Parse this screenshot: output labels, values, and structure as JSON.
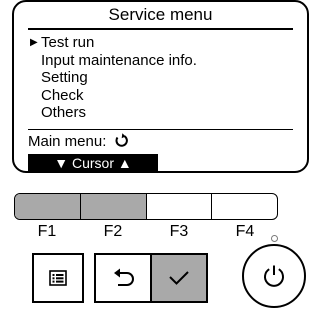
{
  "screen": {
    "title": "Service menu",
    "items": [
      {
        "label": "Test run",
        "selected": true
      },
      {
        "label": "Input maintenance info.",
        "selected": false
      },
      {
        "label": "Setting",
        "selected": false
      },
      {
        "label": "Check",
        "selected": false
      },
      {
        "label": "Others",
        "selected": false
      }
    ],
    "cursor_glyph": "▶",
    "main_menu_label": "Main menu:",
    "main_menu_icon": "return-arrow-icon",
    "cursor_hint": "▼ Cursor ▲"
  },
  "function_keys": [
    {
      "label": "F1",
      "active": true
    },
    {
      "label": "F2",
      "active": true
    },
    {
      "label": "F3",
      "active": false
    },
    {
      "label": "F4",
      "active": false
    }
  ],
  "buttons": {
    "menu_icon": "menu-list-icon",
    "back_icon": "return-arrow-icon",
    "ok_icon": "checkmark-icon",
    "power_icon": "power-icon"
  },
  "colors": {
    "active_key": "#a9a9a9",
    "ok_button": "#a9a9a9",
    "led_ring": "#7a7a7a"
  }
}
